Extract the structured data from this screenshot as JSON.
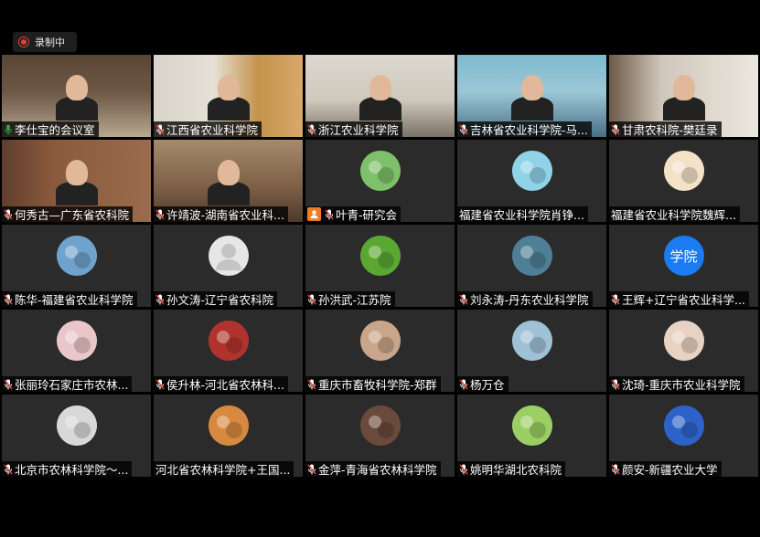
{
  "recording": {
    "label": "录制中",
    "color": "#e0413a"
  },
  "colors": {
    "mic_muted": "#e0413a",
    "mic_active": "#2e9e48",
    "active_border": "#2e9e48",
    "host_badge": "#f07b26",
    "text_avatar": "#1a7bf2"
  },
  "tiles": [
    {
      "name": "李仕宝的会议室",
      "mic": "active",
      "type": "video",
      "scene": "s-room1",
      "active": true
    },
    {
      "name": "江西省农业科学院",
      "mic": "muted",
      "type": "video",
      "scene": "s-room2"
    },
    {
      "name": "浙江农业科学院",
      "mic": "muted",
      "type": "video",
      "scene": "s-room3"
    },
    {
      "name": "吉林省农业科学院-马...",
      "mic": "muted",
      "type": "video",
      "scene": "s-room4"
    },
    {
      "name": "甘肃农科院-樊廷录",
      "mic": "muted",
      "type": "video",
      "scene": "s-room5"
    },
    {
      "name": "何秀古—广东省农科院",
      "mic": "muted",
      "type": "video",
      "scene": "s-room6"
    },
    {
      "name": "许靖波-湖南省农业科...",
      "mic": "muted",
      "type": "video",
      "scene": "s-room7"
    },
    {
      "name": "叶青-研究会",
      "mic": "muted",
      "type": "avatar",
      "avatar_icon": "landscape-avatar",
      "av_bg": "#7fc06a",
      "host": true
    },
    {
      "name": "福建省农业科学院肖铮...",
      "mic": "none",
      "type": "avatar",
      "avatar_icon": "cartoon-bird-avatar",
      "av_bg": "#8fd3e8"
    },
    {
      "name": "福建省农业科学院魏辉...",
      "mic": "none",
      "type": "avatar",
      "avatar_icon": "cartoon-rabbit-avatar",
      "av_bg": "#f3e2c8"
    },
    {
      "name": "陈华-福建省农业科学院",
      "mic": "muted",
      "type": "avatar",
      "avatar_icon": "eagle-avatar",
      "av_bg": "#6fa3cc"
    },
    {
      "name": "孙文涛-辽宁省农科院",
      "mic": "muted",
      "type": "avatar",
      "avatar_icon": "default-user-avatar",
      "av_bg": "#e6e6e6"
    },
    {
      "name": "孙洪武-江苏院",
      "mic": "muted",
      "type": "avatar",
      "avatar_icon": "limes-avatar",
      "av_bg": "#5aa832"
    },
    {
      "name": "刘永涛-丹东农业科学院",
      "mic": "muted",
      "type": "avatar",
      "avatar_icon": "field-photo-avatar",
      "av_bg": "#4f7f96"
    },
    {
      "name": "王辉+辽宁省农业科学...",
      "mic": "muted",
      "type": "avatar",
      "avatar_icon": "text-avatar",
      "avatar_text": "学院",
      "av_bg": "#1a7bf2"
    },
    {
      "name": "张丽玲石家庄市农林...",
      "mic": "muted",
      "type": "avatar",
      "avatar_icon": "portrait-avatar",
      "av_bg": "#e9c7c9"
    },
    {
      "name": "侯升林-河北省农林科...",
      "mic": "muted",
      "type": "avatar",
      "avatar_icon": "cherries-avatar",
      "av_bg": "#b0342d"
    },
    {
      "name": "重庆市畜牧科学院-郑群",
      "mic": "muted",
      "type": "avatar",
      "avatar_icon": "plant-avatar",
      "av_bg": "#c9a58a"
    },
    {
      "name": "杨万仓",
      "mic": "muted",
      "type": "avatar",
      "avatar_icon": "person-outdoor-avatar",
      "av_bg": "#9fc1d6"
    },
    {
      "name": "沈琦-重庆市农业科学院",
      "mic": "muted",
      "type": "avatar",
      "avatar_icon": "woman-portrait-avatar",
      "av_bg": "#e8d2c2"
    },
    {
      "name": "北京市农林科学院～...",
      "mic": "muted",
      "type": "avatar",
      "avatar_icon": "sketch-portrait-avatar",
      "av_bg": "#d8d8d8"
    },
    {
      "name": "河北省农林科学院+王国...",
      "mic": "none",
      "type": "avatar",
      "avatar_icon": "sunset-avatar",
      "av_bg": "#d78a3f"
    },
    {
      "name": "金萍-青海省农林科学院",
      "mic": "muted",
      "type": "avatar",
      "avatar_icon": "food-plate-avatar",
      "av_bg": "#6a4a3a"
    },
    {
      "name": "姚明华湖北农科院",
      "mic": "muted",
      "type": "avatar",
      "avatar_icon": "vegetables-avatar",
      "av_bg": "#9ccf63"
    },
    {
      "name": "颜安-新疆农业大学",
      "mic": "muted",
      "type": "avatar",
      "avatar_icon": "blue-sky-avatar",
      "av_bg": "#2d63c8"
    }
  ]
}
